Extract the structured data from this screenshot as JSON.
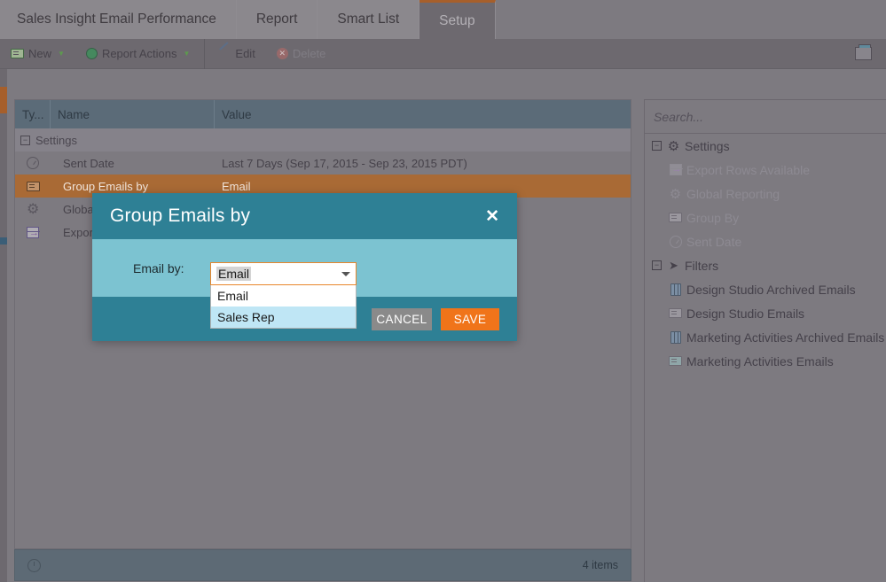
{
  "tabs": [
    {
      "label": "Sales Insight Email Performance",
      "active": false
    },
    {
      "label": "Report",
      "active": false
    },
    {
      "label": "Smart List",
      "active": false
    },
    {
      "label": "Setup",
      "active": true
    }
  ],
  "toolbar": {
    "new_label": "New",
    "report_actions_label": "Report Actions",
    "edit_label": "Edit",
    "delete_label": "Delete",
    "panel_toggle_icon": "window-panel-icon"
  },
  "grid": {
    "columns": [
      "Ty...",
      "Name",
      "Value"
    ],
    "group_label": "Settings",
    "rows": [
      {
        "icon": "clock-icon",
        "name": "Sent Date",
        "value": "Last 7 Days (Sep 17, 2015 - Sep 23, 2015 PDT)",
        "selected": false
      },
      {
        "icon": "card-icon",
        "name": "Group Emails by",
        "value": "Email",
        "selected": true
      },
      {
        "icon": "gear-icon",
        "name": "Global Reporting",
        "value": "",
        "selected": false
      },
      {
        "icon": "export-icon",
        "name": "Export Rows Available",
        "value": "",
        "selected": false
      }
    ]
  },
  "statusbar": {
    "refresh_icon": "refresh-icon",
    "count_label": "4 items"
  },
  "tree": {
    "search_placeholder": "Search...",
    "search_value": "",
    "groups": [
      {
        "label": "Settings",
        "icon": "gear-icon",
        "expanded": true,
        "dim": false,
        "children": [
          {
            "label": "Export Rows Available",
            "icon": "export-icon",
            "dim": true
          },
          {
            "label": "Global Reporting",
            "icon": "gear-icon",
            "dim": true
          },
          {
            "label": "Group By",
            "icon": "card-icon",
            "dim": true
          },
          {
            "label": "Sent Date",
            "icon": "clock-icon",
            "dim": true
          }
        ]
      },
      {
        "label": "Filters",
        "icon": "funnel-icon",
        "expanded": true,
        "dim": false,
        "children": [
          {
            "label": "Design Studio Archived Emails",
            "icon": "database-icon",
            "dim": false
          },
          {
            "label": "Design Studio Emails",
            "icon": "card-icon",
            "dim": false
          },
          {
            "label": "Marketing Activities Archived Emails",
            "icon": "database-icon",
            "dim": false
          },
          {
            "label": "Marketing Activities Emails",
            "icon": "card-icon",
            "dim": false
          }
        ]
      }
    ]
  },
  "modal": {
    "title": "Group Emails by",
    "close_icon": "close-icon",
    "field_label": "Email by:",
    "select": {
      "value": "Email",
      "options": [
        {
          "label": "Email",
          "highlighted": false
        },
        {
          "label": "Sales Rep",
          "highlighted": true
        }
      ]
    },
    "cancel_label": "CANCEL",
    "save_label": "SAVE"
  },
  "colors": {
    "accent_orange": "#f0741a",
    "modal_header_teal": "#2e8095",
    "modal_body_teal": "#7cc3d1",
    "selected_row": "#a96a35",
    "grid_header": "#5b6b78",
    "page_bg": "#7d7a80",
    "option_highlight": "#bfe6f5"
  }
}
